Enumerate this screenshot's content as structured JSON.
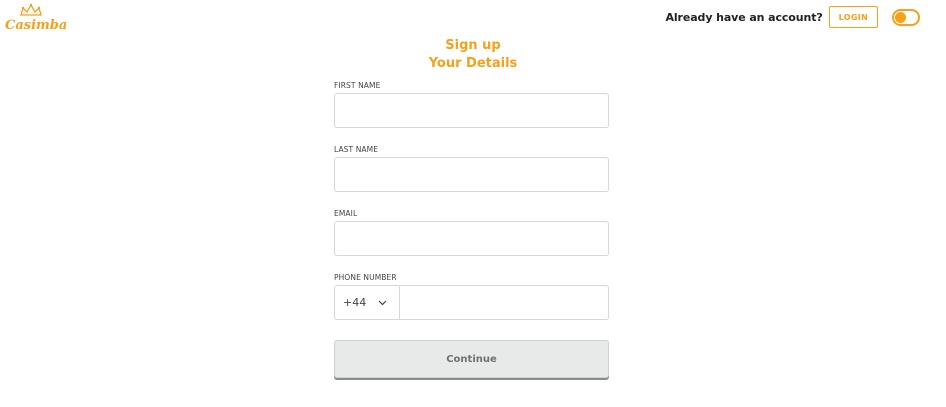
{
  "brand": {
    "name": "Casimba",
    "accent_color": "#f7a01a",
    "logo_icon": "crown-logo-icon"
  },
  "header": {
    "account_prompt": "Already have an account?",
    "login_label": "LOGIN",
    "toggle_icon": "theme-toggle-icon"
  },
  "form": {
    "title": "Sign up",
    "subtitle": "Your Details",
    "first_name": {
      "label": "FIRST NAME",
      "value": ""
    },
    "last_name": {
      "label": "LAST NAME",
      "value": ""
    },
    "email": {
      "label": "EMAIL",
      "value": ""
    },
    "phone": {
      "label": "PHONE NUMBER",
      "country_code": "+44",
      "value": "",
      "dropdown_icon": "chevron-down-icon"
    },
    "continue_label": "Continue"
  }
}
